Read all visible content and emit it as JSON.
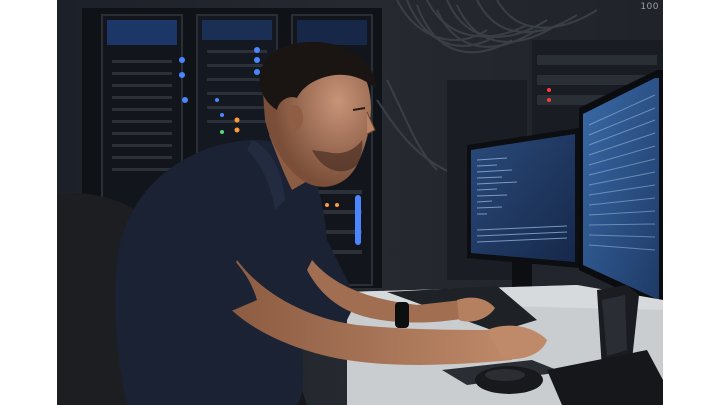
{
  "image": {
    "subject": "technician-at-server-room-workstation",
    "watermark": "100"
  },
  "colors": {
    "room_dark": "#15181d",
    "rack_led_blue": "#3f7dff",
    "rack_led_orange": "#ff9a3c",
    "rack_led_red": "#ff3b3b",
    "monitor_glow": "#6ea0d8",
    "shirt": "#1b2233",
    "skin": "#b07a5c",
    "desk": "#cfd3d6"
  }
}
